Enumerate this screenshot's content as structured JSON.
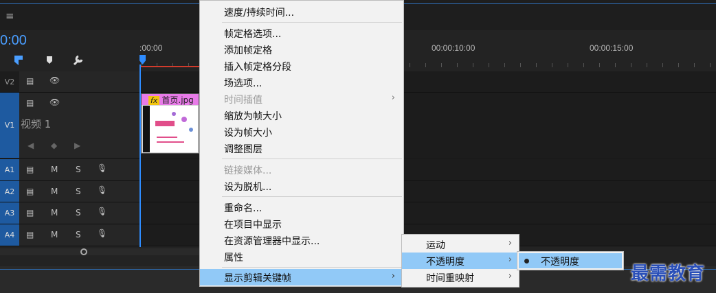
{
  "header": {
    "menu_icon": "hamburger-icon",
    "timecode": "0:00"
  },
  "ruler": {
    "labels": [
      ":00:00",
      "00:00:10:00",
      "00:00:15:00"
    ]
  },
  "tracks": {
    "video": [
      {
        "id": "V2"
      },
      {
        "id": "V1",
        "name": "视频 1"
      }
    ],
    "audio": [
      {
        "id": "A1",
        "m": "M",
        "s": "S"
      },
      {
        "id": "A2",
        "m": "M",
        "s": "S"
      },
      {
        "id": "A3",
        "m": "M",
        "s": "S"
      },
      {
        "id": "A4",
        "m": "M",
        "s": "S"
      }
    ]
  },
  "clip": {
    "fx": "fx",
    "name": "首页.jpg"
  },
  "context_menu": {
    "items": [
      {
        "label": "速度/持续时间..."
      },
      {
        "label": "帧定格选项..."
      },
      {
        "label": "添加帧定格"
      },
      {
        "label": "插入帧定格分段"
      },
      {
        "label": "场选项..."
      },
      {
        "label": "时间插值"
      },
      {
        "label": "缩放为帧大小"
      },
      {
        "label": "设为帧大小"
      },
      {
        "label": "调整图层"
      },
      {
        "label": "链接媒体..."
      },
      {
        "label": "设为脱机..."
      },
      {
        "label": "重命名..."
      },
      {
        "label": "在项目中显示"
      },
      {
        "label": "在资源管理器中显示..."
      },
      {
        "label": "属性"
      },
      {
        "label": "显示剪辑关键帧"
      }
    ],
    "arrow": "›"
  },
  "submenu": {
    "items": [
      {
        "label": "运动"
      },
      {
        "label": "不透明度"
      },
      {
        "label": "时间重映射"
      }
    ]
  },
  "submenu2": {
    "items": [
      {
        "label": "不透明度",
        "checked": true
      }
    ]
  },
  "watermark": "最需教育",
  "colors": {
    "accent": "#2e8cff",
    "menu_highlight": "#91c9f7",
    "track_selected": "#1e5aa0"
  }
}
